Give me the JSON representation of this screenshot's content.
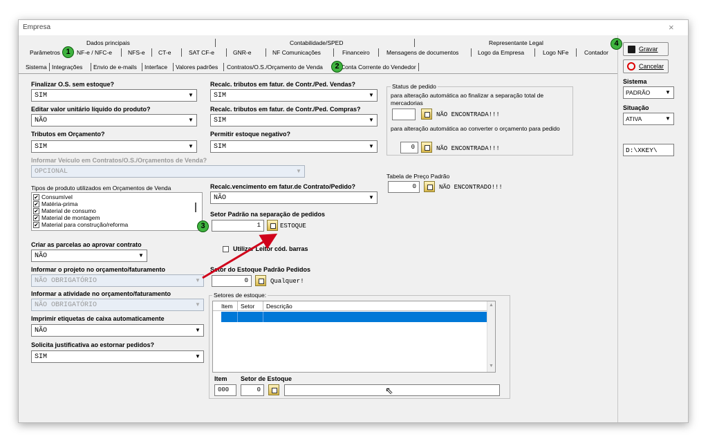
{
  "window": {
    "title": "Empresa",
    "close": "×"
  },
  "top_tab_groups": [
    "Dados principais",
    "Contabilidade/SPED",
    "Representante Legal"
  ],
  "tabs": [
    "Parâmetros",
    "NF-e / NFC-e",
    "NFS-e",
    "CT-e",
    "SAT CF-e",
    "GNR-e",
    "NF Comunicações",
    "Financeiro",
    "Mensagens de documentos",
    "Logo da Empresa",
    "Logo NFe",
    "Contador"
  ],
  "subtabs": [
    "Sistema",
    "Integrações",
    "Envio de e-mails",
    "Interface",
    "Valores padrões",
    "Contratos/O.S./Orçamento de Venda",
    "Conta Corrente do Vendedor"
  ],
  "badges": [
    "1",
    "2",
    "3",
    "4"
  ],
  "left": {
    "finalizar_label": "Finalizar O.S. sem estoque?",
    "finalizar_value": "SIM",
    "editar_label": "Editar valor unitário líquido do produto?",
    "editar_value": "NÃO",
    "tributos_label": "Tributos em Orçamento?",
    "tributos_value": "SIM",
    "veiculo_label": "Informar Veículo em Contratos/O.S./Orçamentos de Venda?",
    "veiculo_value": "OPCIONAL",
    "tipos_label": "Tipos de produto utilizados em Orçamentos de Venda",
    "tipos": [
      "Consumível",
      "Matéria-prima",
      "Material de consumo",
      "Material de montagem",
      "Material para construção/reforma"
    ],
    "parcelas_label": "Criar as parcelas ao aprovar contrato",
    "parcelas_value": "NÃO",
    "projeto_label": "Informar o projeto no orçamento/faturamento",
    "projeto_value": "NÃO OBRIGATÓRIO",
    "atividade_label": "Informar a atividade no orçamento/faturamento",
    "atividade_value": "NÃO OBRIGATÓRIO",
    "etiquetas_label": "Imprimir etiquetas de caixa automaticamente",
    "etiquetas_value": "NÃO",
    "justificativa_label": "Solicita justificativa ao estornar pedidos?",
    "justificativa_value": "SIM"
  },
  "middle": {
    "recalc_vendas_label": "Recalc. tributos em fatur. de Contr./Ped. Vendas?",
    "recalc_vendas_value": "SIM",
    "recalc_compras_label": "Recalc. tributos em fatur. de Contr./Ped. Compras?",
    "recalc_compras_value": "SIM",
    "estoque_neg_label": "Permitir estoque negativo?",
    "estoque_neg_value": "SIM",
    "recalc_venc_label": "Recalc.vencimento em fatur.de Contrato/Pedido?",
    "recalc_venc_value": "NÃO",
    "setor_padrao_label": "Setor Padrão na separação de pedidos",
    "setor_padrao_value": "1",
    "setor_padrao_desc": "ESTOQUE",
    "leitor_label": "Utilizar Leitor cód. barras",
    "setor_estoque_label": "Setor do Estoque Padrão Pedidos",
    "setor_estoque_value": "0",
    "setor_estoque_desc": "Qualquer!",
    "setores_title": "Setores de estoque:",
    "grid_cols": [
      "Item",
      "Setor",
      "Descrição"
    ],
    "item_label": "Item",
    "item_value": "000",
    "setor_label": "Setor de Estoque",
    "setor_value": "0"
  },
  "right": {
    "status_title": "Status de pedido",
    "status_text1": "para alteração automática ao finalizar a separação total de mercadorias",
    "status_desc1": "NÃO ENCONTRADA!!!",
    "status_text2": "para alteração automática ao converter o orçamento para pedido",
    "status_value2": "0",
    "status_desc2": "NÃO ENCONTRADA!!!",
    "tabela_label": "Tabela de Preço Padrão",
    "tabela_value": "0",
    "tabela_desc": "NÃO ENCONTRADO!!!"
  },
  "side": {
    "gravar": "Gravar",
    "cancelar": "Cancelar",
    "sistema_label": "Sistema",
    "sistema_value": "PADRÃO",
    "situacao_label": "Situação",
    "situacao_value": "ATIVA",
    "path_value": "D:\\XKEY\\"
  },
  "colors": {
    "grid_selected": "#0078d7",
    "badge": "#3fb33f",
    "arrow": "#d0021b"
  }
}
